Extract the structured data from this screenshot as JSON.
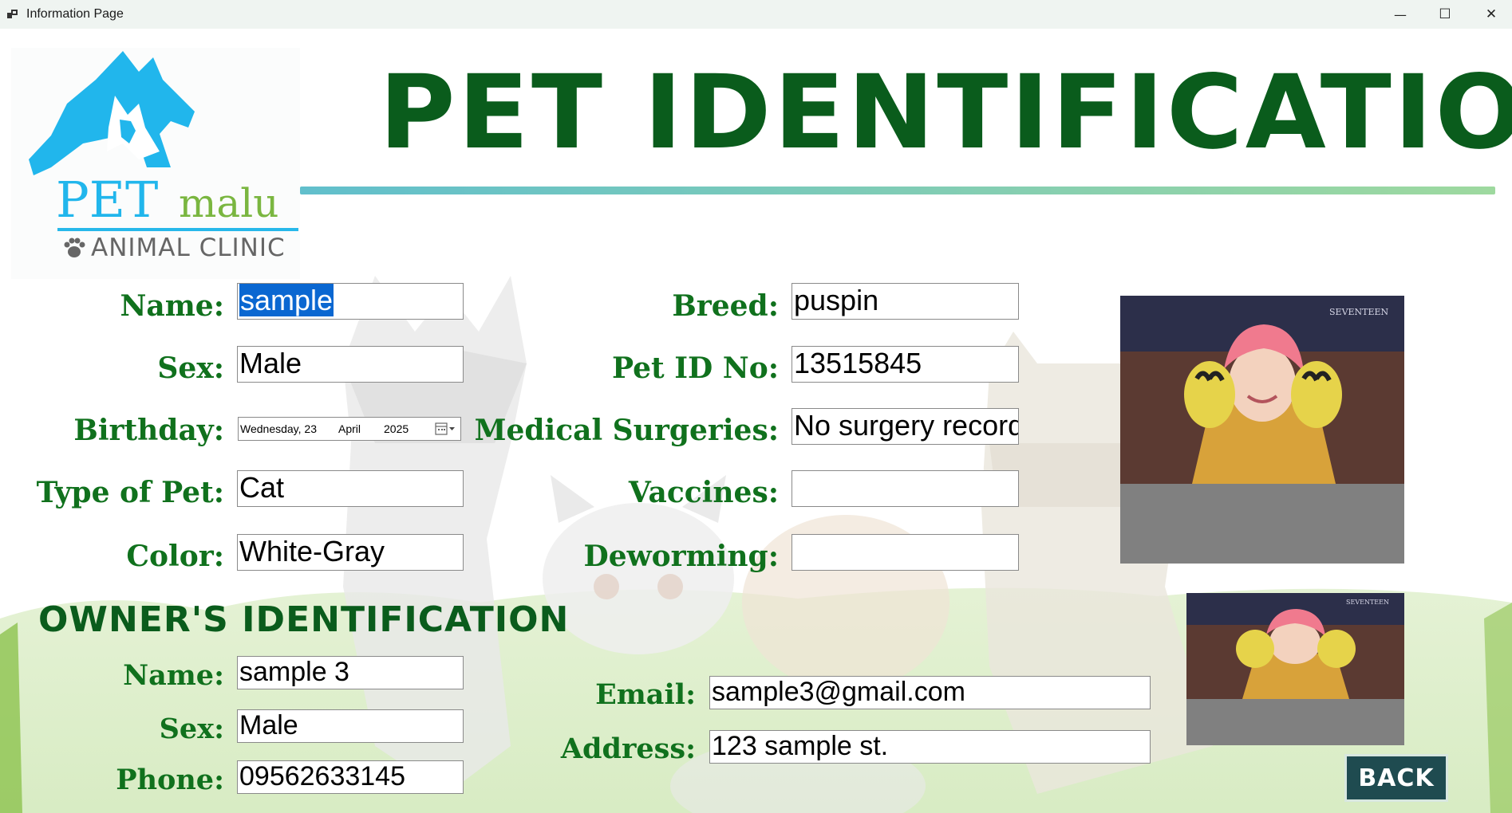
{
  "window": {
    "title": "Information Page",
    "controls": {
      "minimize": "—",
      "maximize": "☐",
      "close": "✕"
    }
  },
  "logo": {
    "brand_pet": "PET",
    "brand_malu": "malu",
    "clinic": "ANIMAL CLINIC",
    "colors": {
      "pet": "#21b6ec",
      "malu": "#7ab640"
    }
  },
  "header": {
    "title": "PET IDENTIFICATION",
    "color": "#0a5c1c"
  },
  "pet": {
    "name_label": "Name:",
    "name_value": "sample",
    "sex_label": "Sex:",
    "sex_value": "Male",
    "birthday_label": "Birthday:",
    "birthday": {
      "weekday_day": "Wednesday, 23",
      "month": "April",
      "year": "2025"
    },
    "type_label": "Type of Pet:",
    "type_value": "Cat",
    "color_label": "Color:",
    "color_value": "White-Gray",
    "breed_label": "Breed:",
    "breed_value": "puspin",
    "id_label": "Pet ID No:",
    "id_value": "13515845",
    "surgeries_label": "Medical Surgeries:",
    "surgeries_value": "No surgery record",
    "vaccines_label": "Vaccines:",
    "vaccines_value": "",
    "deworming_label": "Deworming:",
    "deworming_value": ""
  },
  "owner": {
    "section_title": "OWNER'S IDENTIFICATION",
    "name_label": "Name:",
    "name_value": "sample 3",
    "sex_label": "Sex:",
    "sex_value": "Male",
    "phone_label": "Phone:",
    "phone_value": "09562633145",
    "email_label": "Email:",
    "email_value": "sample3@gmail.com",
    "address_label": "Address:",
    "address_value": "123 sample st."
  },
  "photos": {
    "watermark": "SEVENTEEN"
  },
  "actions": {
    "back_label": "BACK"
  },
  "colors": {
    "label_green": "#10711d",
    "selection": "#0a67d1",
    "back_button": "#1f4b50"
  }
}
